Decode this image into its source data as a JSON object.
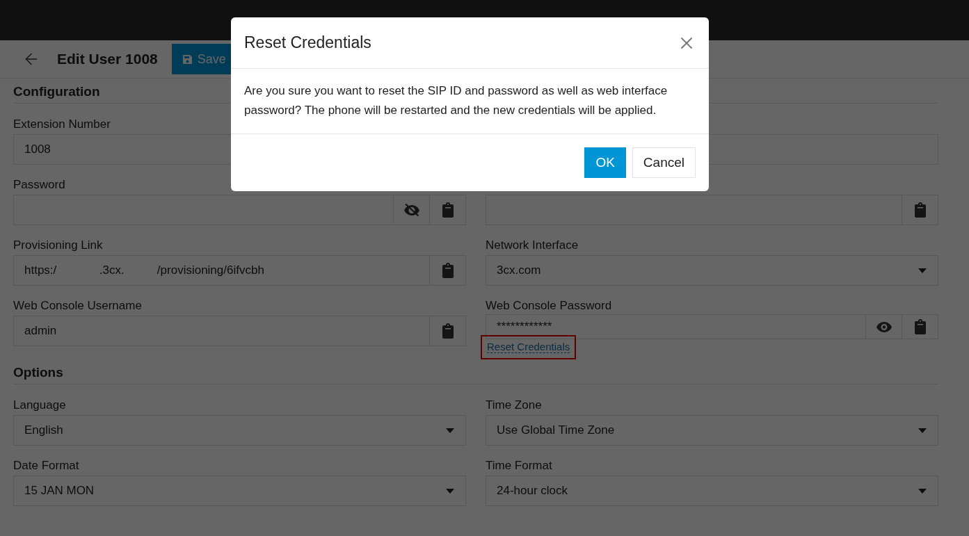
{
  "header": {
    "title": "Edit User 1008",
    "save_label": "Save"
  },
  "sections": [
    {
      "title": "Configuration",
      "fields": [
        {
          "label": "Extension Number",
          "value": "1008",
          "kind": "text"
        },
        {
          "kind": "text"
        },
        {
          "label": "Password",
          "kind": "text",
          "password_visible": false,
          "copy": true
        },
        {
          "kind": "text",
          "copy": true
        },
        {
          "label": "Provisioning Link",
          "value": "https:/             .3cx.          /provisioning/6ifvcbh",
          "kind": "text",
          "copy": true
        },
        {
          "label": "Network Interface",
          "value": "3cx.com",
          "kind": "select"
        },
        {
          "label": "Web Console Username",
          "value": "admin",
          "kind": "text",
          "copy": true
        },
        {
          "label": "Web Console Password",
          "value": "************",
          "kind": "text",
          "password_visible": true,
          "copy": true,
          "link": {
            "text": "Reset Credentials",
            "highlighted": true
          }
        }
      ]
    },
    {
      "title": "Options",
      "fields": [
        {
          "label": "Language",
          "value": "English",
          "kind": "select"
        },
        {
          "label": "Time Zone",
          "value": "Use Global Time Zone",
          "kind": "select"
        },
        {
          "label": "Date Format",
          "value": "15 JAN MON",
          "kind": "select"
        },
        {
          "label": "Time Format",
          "value": "24-hour clock",
          "kind": "select"
        }
      ]
    }
  ],
  "dialog": {
    "title": "Reset Credentials",
    "message": "Are you sure you want to reset the SIP ID and password as well as web interface password? The phone will be restarted and the new credentials will be applied.",
    "buttons": [
      {
        "label": "OK",
        "kind": "primary"
      },
      {
        "label": "Cancel",
        "kind": "secondary"
      }
    ]
  }
}
